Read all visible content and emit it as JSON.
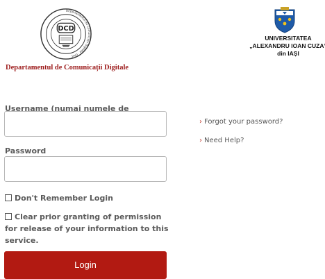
{
  "header": {
    "dcd_logo_text": "DCD",
    "dcd_ring_text": "Departamentul de Comunicații Digitale · UAIC",
    "dcd_name": "Departamentul de Comunicații Digitale",
    "uaic_line1": "UNIVERSITATEA",
    "uaic_line2": "„ALEXANDRU IOAN CUZA”",
    "uaic_line3": "din IAȘI"
  },
  "form": {
    "username_label": "Username (numai numele de utilizator, fara @uaic.ro)",
    "username_value": "",
    "password_label": "Password",
    "password_value": "",
    "remember_label": "Don't Remember Login",
    "clear_label": "Clear prior granting of permission for release of your information to this service.",
    "login_label": "Login"
  },
  "links": {
    "forgot": "Forgot your password?",
    "help": "Need Help?"
  },
  "colors": {
    "brand_red": "#b21a12",
    "dcd_red": "#9c1a1a"
  }
}
